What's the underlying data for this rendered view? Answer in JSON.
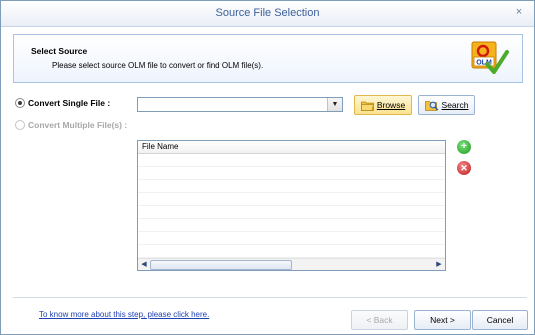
{
  "window": {
    "title": "Source File Selection",
    "close_glyph": "×"
  },
  "header": {
    "title": "Select Source",
    "description": "Please select source OLM file to convert or find OLM file(s).",
    "logo_text": "OLM",
    "logo_icon": "olm-check-icon"
  },
  "options": {
    "single_label": "Convert Single File :",
    "multiple_label": "Convert Multiple File(s) :",
    "single_selected": true,
    "file_path_value": ""
  },
  "buttons": {
    "browse": "Browse",
    "search": "Search",
    "back": "< Back",
    "next": "Next >",
    "cancel": "Cancel"
  },
  "file_list": {
    "column_header": "File Name",
    "rows": []
  },
  "footer": {
    "help_link": "To know more about this step, please click here."
  },
  "colors": {
    "title": "#3b5f9a",
    "link": "#1f3fb5",
    "add": "#1f9a1f",
    "remove": "#c21818"
  }
}
